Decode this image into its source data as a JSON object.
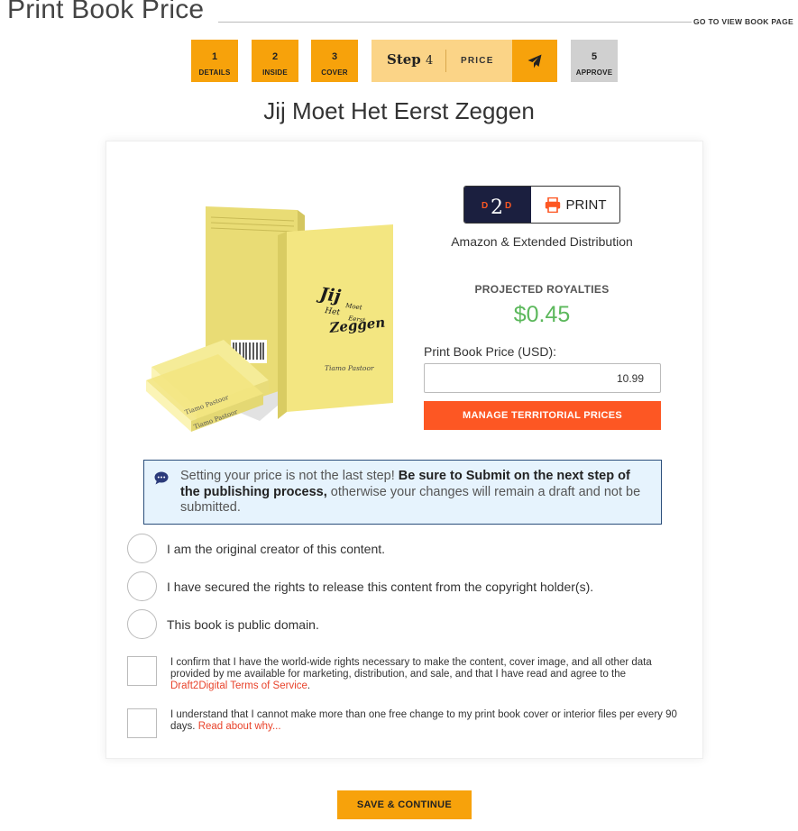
{
  "header": {
    "title": "Print Book Price",
    "view_link": "GO TO VIEW BOOK PAGE"
  },
  "steps": [
    {
      "num": "1",
      "label": "DETAILS"
    },
    {
      "num": "2",
      "label": "INSIDE"
    },
    {
      "num": "3",
      "label": "COVER"
    },
    {
      "name": "Step",
      "num": "4",
      "label": "PRICE",
      "icon": "paper-plane-icon"
    },
    {
      "num": "5",
      "label": "APPROVE"
    }
  ],
  "book": {
    "title": "Jij Moet Het Eerst Zeggen",
    "cover_title_lines": [
      "Jij",
      "Moet",
      "Het",
      "Eerst",
      "Zeggen"
    ],
    "author": "Tiamo Pastoor"
  },
  "distribution": {
    "badge_logo": "D2D",
    "badge_label": "PRINT",
    "channel": "Amazon & Extended Distribution"
  },
  "royalties": {
    "label": "PROJECTED ROYALTIES",
    "value": "$0.45"
  },
  "price": {
    "label": "Print Book Price (USD):",
    "value": "10.99",
    "territorial_button": "MANAGE TERRITORIAL PRICES"
  },
  "notice": {
    "text_1": "Setting your price is not the last step! ",
    "bold": "Be sure to Submit on the next step of the publishing process,",
    "text_2": " otherwise your changes will remain a draft and not be submitted."
  },
  "rights_options": [
    "I am the original creator of this content.",
    "I have secured the rights to release this content from the copyright holder(s).",
    "This book is public domain."
  ],
  "confirmations": {
    "rights_text": "I confirm that I have the world-wide rights necessary to make the content, cover image, and all other data provided by me available for marketing, distribution, and sale, and that I have read and agree to the ",
    "rights_link": "Draft2Digital Terms of Service",
    "rights_end": ".",
    "change_text": "I understand that I cannot make more than one free change to my print book cover or interior files per every 90 days. ",
    "change_link": "Read about why..."
  },
  "actions": {
    "save": "SAVE & CONTINUE"
  },
  "colors": {
    "step_orange": "#f7a20b",
    "step_active_light": "#fbd487",
    "step_inactive": "#d0d0d0",
    "royalty_green": "#5cb85c",
    "territorial_orange": "#fd5723",
    "d2d_navy": "#1b1f3f",
    "notice_bg": "#e6f3fd",
    "book_yellow": "#f3e681"
  }
}
